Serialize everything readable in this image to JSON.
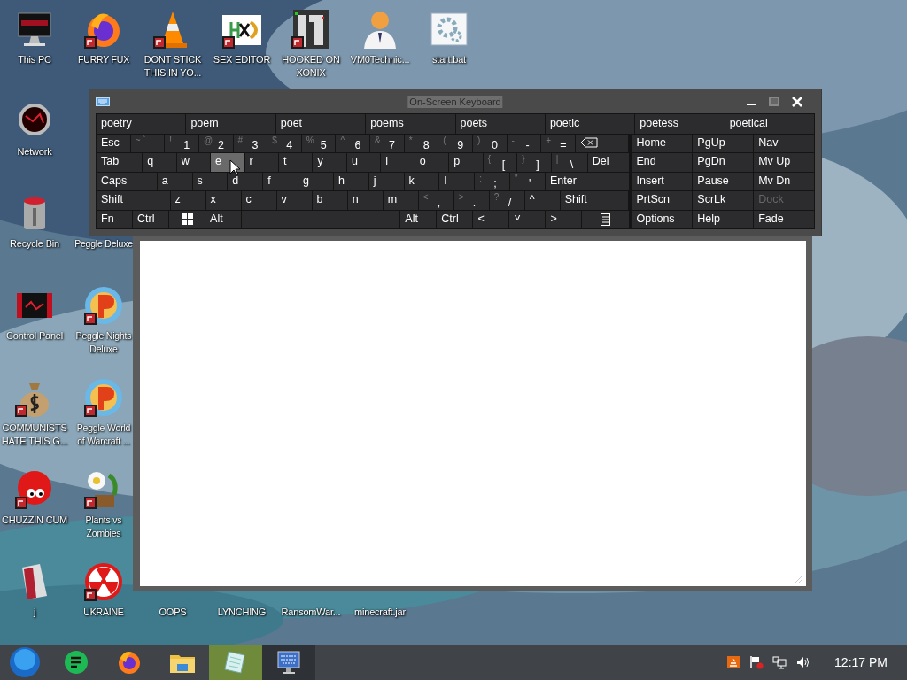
{
  "desktop": {
    "icons": [
      {
        "label": "This PC",
        "kind": "monitor",
        "shortcut": false
      },
      {
        "label": "FURRY FUX",
        "kind": "fox",
        "shortcut": true
      },
      {
        "label": "DONT STICK THIS IN YO...",
        "kind": "cone",
        "shortcut": true
      },
      {
        "label": "SEX EDITOR",
        "kind": "hex",
        "shortcut": true
      },
      {
        "label": "HOOKED ON XONIX",
        "kind": "maze",
        "shortcut": true
      },
      {
        "label": "VM0Technic...",
        "kind": "person",
        "shortcut": false
      },
      {
        "label": "start.bat",
        "kind": "gear",
        "shortcut": false
      },
      {
        "label": "Network",
        "kind": "globe",
        "shortcut": false
      },
      {
        "label": "Recycle Bin",
        "kind": "bin",
        "shortcut": false
      },
      {
        "label": "Peggle Deluxe",
        "kind": "hidden"
      },
      {
        "label": "Control Panel",
        "kind": "panel",
        "shortcut": false
      },
      {
        "label": "Peggle Nights Deluxe",
        "kind": "peggle",
        "shortcut": true
      },
      {
        "label": "COMMUNISTS HATE THIS G...",
        "kind": "money",
        "shortcut": true
      },
      {
        "label": "Peggle World of Warcraft ...",
        "kind": "peggle",
        "shortcut": true
      },
      {
        "label": "CHUZZIN CUM",
        "kind": "fuzzball",
        "shortcut": true
      },
      {
        "label": "Plants vs Zombies",
        "kind": "flower",
        "shortcut": true
      },
      {
        "label": "j",
        "kind": "folder",
        "shortcut": false
      },
      {
        "label": "UKRAINE",
        "kind": "radiation",
        "shortcut": true
      },
      {
        "label": "OOPS",
        "kind": "hidden"
      },
      {
        "label": "LYNCHING",
        "kind": "hidden"
      },
      {
        "label": "RansomWar...",
        "kind": "hidden"
      },
      {
        "label": "minecraft.jar",
        "kind": "hidden"
      }
    ]
  },
  "keyboard": {
    "title": "On-Screen Keyboard",
    "suggestions": [
      "poetry",
      "poem",
      "poet",
      "poems",
      "poets",
      "poetic",
      "poetess",
      "poetical"
    ],
    "rows": [
      [
        {
          "kind": "key",
          "label": "Esc",
          "hover": false
        },
        {
          "kind": "key",
          "shift": "~ `",
          "hover": false
        },
        {
          "kind": "key",
          "shift": "!",
          "label": "1",
          "hover": false
        },
        {
          "kind": "key",
          "shift": "@",
          "label": "2",
          "hover": false
        },
        {
          "kind": "key",
          "shift": "#",
          "label": "3",
          "hover": false
        },
        {
          "kind": "key",
          "shift": "$",
          "label": "4",
          "hover": false
        },
        {
          "kind": "key",
          "shift": "%",
          "label": "5",
          "hover": false
        },
        {
          "kind": "key",
          "shift": "^",
          "label": "6",
          "hover": false
        },
        {
          "kind": "key",
          "shift": "&",
          "label": "7",
          "hover": false
        },
        {
          "kind": "key",
          "shift": "*",
          "label": "8",
          "hover": false
        },
        {
          "kind": "key",
          "shift": "(",
          "label": "9",
          "hover": false
        },
        {
          "kind": "key",
          "shift": ")",
          "label": "0",
          "hover": false
        },
        {
          "kind": "key",
          "shift": "-",
          "label": "-",
          "hover": false
        },
        {
          "kind": "key",
          "shift": "+",
          "label": "=",
          "hover": false
        },
        {
          "kind": "backspace",
          "hover": false
        }
      ],
      [
        {
          "kind": "key",
          "label": "Tab",
          "hover": false
        },
        {
          "kind": "key",
          "label": "q",
          "hover": false
        },
        {
          "kind": "key",
          "label": "w",
          "hover": false
        },
        {
          "kind": "key",
          "label": "e",
          "hover": true
        },
        {
          "kind": "key",
          "label": "r",
          "hover": false
        },
        {
          "kind": "key",
          "label": "t",
          "hover": false
        },
        {
          "kind": "key",
          "label": "y",
          "hover": false
        },
        {
          "kind": "key",
          "label": "u",
          "hover": false
        },
        {
          "kind": "key",
          "label": "i",
          "hover": false
        },
        {
          "kind": "key",
          "label": "o",
          "hover": false
        },
        {
          "kind": "key",
          "label": "p",
          "hover": false
        },
        {
          "kind": "key",
          "shift": "{",
          "label": "[",
          "hover": false
        },
        {
          "kind": "key",
          "shift": "}",
          "label": "]",
          "hover": false
        },
        {
          "kind": "key",
          "shift": "|",
          "label": "\\",
          "hover": false
        },
        {
          "kind": "key",
          "label": "Del",
          "hover": false
        }
      ],
      [
        {
          "kind": "key",
          "label": "Caps",
          "hover": false
        },
        {
          "kind": "key",
          "label": "a",
          "hover": false
        },
        {
          "kind": "key",
          "label": "s",
          "hover": false
        },
        {
          "kind": "key",
          "label": "d",
          "hover": false
        },
        {
          "kind": "key",
          "label": "f",
          "hover": false
        },
        {
          "kind": "key",
          "label": "g",
          "hover": false
        },
        {
          "kind": "key",
          "label": "h",
          "hover": false
        },
        {
          "kind": "key",
          "label": "j",
          "hover": false
        },
        {
          "kind": "key",
          "label": "k",
          "hover": false
        },
        {
          "kind": "key",
          "label": "l",
          "hover": false
        },
        {
          "kind": "key",
          "shift": ":",
          "label": ";",
          "hover": false
        },
        {
          "kind": "key",
          "shift": "\"",
          "label": "'",
          "hover": false
        },
        {
          "kind": "key",
          "label": "Enter",
          "hover": false
        }
      ],
      [
        {
          "kind": "key",
          "label": "Shift",
          "hover": false
        },
        {
          "kind": "key",
          "label": "z",
          "hover": false
        },
        {
          "kind": "key",
          "label": "x",
          "hover": false
        },
        {
          "kind": "key",
          "label": "c",
          "hover": false
        },
        {
          "kind": "key",
          "label": "v",
          "hover": false
        },
        {
          "kind": "key",
          "label": "b",
          "hover": false
        },
        {
          "kind": "key",
          "label": "n",
          "hover": false
        },
        {
          "kind": "key",
          "label": "m",
          "hover": false
        },
        {
          "kind": "key",
          "shift": "<",
          "label": ",",
          "hover": false
        },
        {
          "kind": "key",
          "shift": ">",
          "label": ".",
          "hover": false
        },
        {
          "kind": "key",
          "shift": "?",
          "label": "/",
          "hover": false
        },
        {
          "kind": "key",
          "label": "^",
          "hover": false
        },
        {
          "kind": "key",
          "label": "Shift",
          "hover": false
        }
      ],
      [
        {
          "kind": "key",
          "label": "Fn",
          "hover": false
        },
        {
          "kind": "key",
          "label": "Ctrl",
          "hover": false
        },
        {
          "kind": "windows",
          "hover": false
        },
        {
          "kind": "key",
          "label": "Alt",
          "hover": false
        },
        {
          "kind": "space",
          "hover": false
        },
        {
          "kind": "key",
          "label": "Alt",
          "hover": false
        },
        {
          "kind": "key",
          "label": "Ctrl",
          "hover": false
        },
        {
          "kind": "key",
          "label": "<",
          "hover": false
        },
        {
          "kind": "key",
          "label": "˅",
          "hover": false
        },
        {
          "kind": "key",
          "label": ">",
          "hover": false
        },
        {
          "kind": "menu",
          "hover": false
        }
      ]
    ],
    "nav": [
      [
        {
          "label": "Home",
          "disabled": false
        },
        {
          "label": "PgUp",
          "disabled": false
        },
        {
          "label": "Nav",
          "disabled": false
        }
      ],
      [
        {
          "label": "End",
          "disabled": false
        },
        {
          "label": "PgDn",
          "disabled": false
        },
        {
          "label": "Mv Up",
          "disabled": false
        }
      ],
      [
        {
          "label": "Insert",
          "disabled": false
        },
        {
          "label": "Pause",
          "disabled": false
        },
        {
          "label": "Mv Dn",
          "disabled": false
        }
      ],
      [
        {
          "label": "PrtScn",
          "disabled": false
        },
        {
          "label": "ScrLk",
          "disabled": false
        },
        {
          "label": "Dock",
          "disabled": true
        }
      ],
      [
        {
          "label": "Options",
          "disabled": false
        },
        {
          "label": "Help",
          "disabled": false
        },
        {
          "label": "Fade",
          "disabled": false
        }
      ]
    ]
  },
  "taskbar": {
    "apps": [
      {
        "kind": "notes",
        "selected": false,
        "open": false
      },
      {
        "kind": "fox",
        "selected": false,
        "open": false
      },
      {
        "kind": "folder",
        "selected": false,
        "open": false
      },
      {
        "kind": "notepad",
        "selected": true,
        "open": true
      },
      {
        "kind": "keyboard",
        "selected": false,
        "open": true
      }
    ],
    "tray": [
      {
        "kind": "app"
      },
      {
        "kind": "flag"
      },
      {
        "kind": "network"
      },
      {
        "kind": "volume"
      }
    ],
    "time": "12:17 PM"
  }
}
